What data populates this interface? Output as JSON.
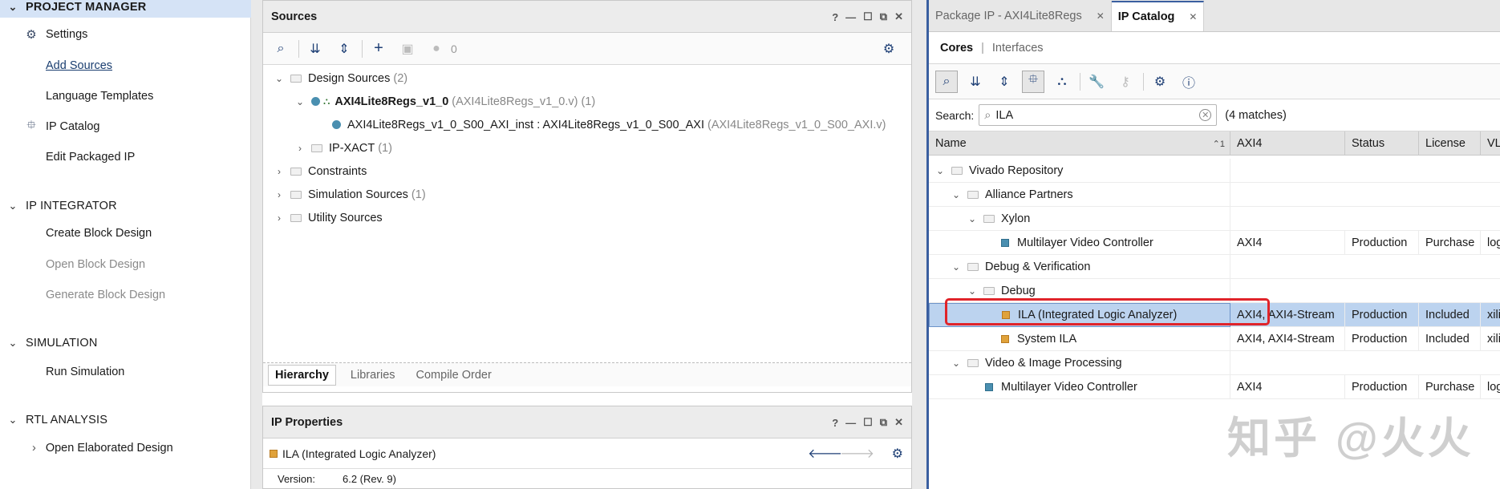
{
  "flow": {
    "sections": [
      {
        "label": "PROJECT MANAGER",
        "items": [
          {
            "label": "Settings",
            "icon": "gear-icon"
          },
          {
            "label": "Add Sources",
            "link": true
          },
          {
            "label": "Language Templates"
          },
          {
            "label": "IP Catalog",
            "icon": "chip-icon"
          },
          {
            "label": "Edit Packaged IP"
          }
        ]
      },
      {
        "label": "IP INTEGRATOR",
        "items": [
          {
            "label": "Create Block Design"
          },
          {
            "label": "Open Block Design",
            "disabled": true
          },
          {
            "label": "Generate Block Design",
            "disabled": true
          }
        ]
      },
      {
        "label": "SIMULATION",
        "items": [
          {
            "label": "Run Simulation"
          }
        ]
      },
      {
        "label": "RTL ANALYSIS",
        "items": [
          {
            "label": "Open Elaborated Design"
          }
        ]
      }
    ]
  },
  "sources": {
    "title": "Sources",
    "count": "0",
    "tree": [
      {
        "label": "Design Sources",
        "suffix": "(2)"
      },
      {
        "label": "AXI4Lite8Regs_v1_0",
        "suffix": "(AXI4Lite8Regs_v1_0.v) (1)"
      },
      {
        "label": "AXI4Lite8Regs_v1_0_S00_AXI_inst : AXI4Lite8Regs_v1_0_S00_AXI",
        "suffix": "(AXI4Lite8Regs_v1_0_S00_AXI.v)"
      },
      {
        "label": "IP-XACT",
        "suffix": "(1)"
      },
      {
        "label": "Constraints",
        "suffix": ""
      },
      {
        "label": "Simulation Sources",
        "suffix": "(1)"
      },
      {
        "label": "Utility Sources",
        "suffix": ""
      }
    ],
    "tabs": [
      "Hierarchy",
      "Libraries",
      "Compile Order"
    ]
  },
  "ip_properties": {
    "title": "IP Properties",
    "selected": "ILA (Integrated Logic Analyzer)",
    "version_label": "Version:",
    "version_value": "6.2 (Rev. 9)"
  },
  "catalog": {
    "tabs": [
      "Package IP - AXI4Lite8Regs",
      "IP Catalog"
    ],
    "subtabs": [
      "Cores",
      "Interfaces"
    ],
    "search_label": "Search:",
    "search_value": "ILA",
    "matches": "(4 matches)",
    "sort_indicator": "1",
    "columns": [
      "Name",
      "AXI4",
      "Status",
      "License",
      "VL"
    ],
    "rows": [
      {
        "name": "Vivado Repository"
      },
      {
        "name": "Alliance Partners"
      },
      {
        "name": "Xylon"
      },
      {
        "name": "Multilayer Video Controller",
        "axi": "AXI4",
        "status": "Production",
        "license": "Purchase",
        "vl": "log"
      },
      {
        "name": "Debug & Verification"
      },
      {
        "name": "Debug"
      },
      {
        "name": "ILA (Integrated Logic Analyzer)",
        "axi": "AXI4, AXI4-Stream",
        "status": "Production",
        "license": "Included",
        "vl": "xili"
      },
      {
        "name": "System ILA",
        "axi": "AXI4, AXI4-Stream",
        "status": "Production",
        "license": "Included",
        "vl": "xili"
      },
      {
        "name": "Video & Image Processing"
      },
      {
        "name": "Multilayer Video Controller",
        "axi": "AXI4",
        "status": "Production",
        "license": "Purchase",
        "vl": "log"
      }
    ]
  },
  "watermark": "知乎 @火火",
  "colors": {
    "selection": "#bcd3ef",
    "highlight_box": "#e0242a",
    "section_highlight": "#d5e3f6"
  }
}
